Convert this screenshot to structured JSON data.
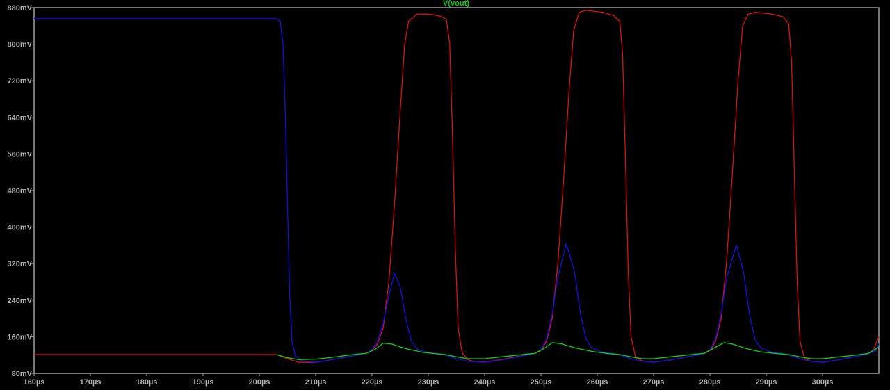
{
  "chart_data": {
    "type": "line",
    "title": "V(vout)",
    "title_color": "#00d000",
    "xlabel": "",
    "ylabel": "",
    "xlim": [
      160,
      310
    ],
    "ylim": [
      80,
      880
    ],
    "x_unit": "µs",
    "y_unit": "mV",
    "grid": false,
    "x_ticks": [
      "160µs",
      "170µs",
      "180µs",
      "190µs",
      "200µs",
      "210µs",
      "220µs",
      "230µs",
      "240µs",
      "250µs",
      "260µs",
      "270µs",
      "280µs",
      "290µs",
      "300µs"
    ],
    "x_tick_values": [
      160,
      170,
      180,
      190,
      200,
      210,
      220,
      230,
      240,
      250,
      260,
      270,
      280,
      290,
      300
    ],
    "y_ticks": [
      "80mV",
      "160mV",
      "240mV",
      "320mV",
      "400mV",
      "480mV",
      "560mV",
      "640mV",
      "720mV",
      "800mV",
      "880mV"
    ],
    "y_tick_values": [
      80,
      160,
      240,
      320,
      400,
      480,
      560,
      640,
      720,
      800,
      880
    ],
    "series": [
      {
        "name": "red-trace",
        "color": "#e01010",
        "points": [
          [
            160,
            121
          ],
          [
            203,
            121
          ],
          [
            205,
            112
          ],
          [
            207,
            104
          ],
          [
            210,
            104
          ],
          [
            213,
            110
          ],
          [
            216,
            117
          ],
          [
            219,
            124
          ],
          [
            220,
            130
          ],
          [
            221,
            145
          ],
          [
            222,
            180
          ],
          [
            223,
            280
          ],
          [
            224,
            450
          ],
          [
            225,
            650
          ],
          [
            225.8,
            800
          ],
          [
            226.5,
            850
          ],
          [
            228,
            866
          ],
          [
            230,
            866
          ],
          [
            232,
            862
          ],
          [
            233.2,
            855
          ],
          [
            233.8,
            800
          ],
          [
            234.3,
            600
          ],
          [
            234.8,
            350
          ],
          [
            235.3,
            180
          ],
          [
            236,
            125
          ],
          [
            237,
            110
          ],
          [
            238,
            106
          ],
          [
            240,
            105
          ],
          [
            243,
            110
          ],
          [
            246,
            117
          ],
          [
            249,
            124
          ],
          [
            250,
            130
          ],
          [
            251,
            150
          ],
          [
            252,
            200
          ],
          [
            253,
            320
          ],
          [
            254,
            500
          ],
          [
            255,
            700
          ],
          [
            255.8,
            830
          ],
          [
            256.8,
            870
          ],
          [
            258,
            874
          ],
          [
            261,
            870
          ],
          [
            263,
            862
          ],
          [
            264,
            850
          ],
          [
            264.5,
            780
          ],
          [
            265,
            550
          ],
          [
            265.5,
            300
          ],
          [
            266,
            160
          ],
          [
            266.8,
            115
          ],
          [
            268,
            107
          ],
          [
            270,
            104
          ],
          [
            273,
            109
          ],
          [
            276,
            116
          ],
          [
            279,
            123
          ],
          [
            280,
            130
          ],
          [
            281,
            150
          ],
          [
            282,
            200
          ],
          [
            283,
            330
          ],
          [
            284,
            520
          ],
          [
            285,
            720
          ],
          [
            285.8,
            840
          ],
          [
            286.8,
            866
          ],
          [
            288,
            870
          ],
          [
            291,
            866
          ],
          [
            293,
            860
          ],
          [
            294,
            845
          ],
          [
            294.5,
            760
          ],
          [
            295,
            520
          ],
          [
            295.5,
            280
          ],
          [
            296,
            150
          ],
          [
            296.8,
            112
          ],
          [
            298,
            106
          ],
          [
            300,
            104
          ],
          [
            303,
            110
          ],
          [
            306,
            117
          ],
          [
            308,
            122
          ],
          [
            309,
            130
          ],
          [
            310,
            160
          ]
        ]
      },
      {
        "name": "blue-trace",
        "color": "#1010e0",
        "points": [
          [
            160,
            856
          ],
          [
            203,
            856
          ],
          [
            203.7,
            850
          ],
          [
            204.2,
            800
          ],
          [
            204.6,
            650
          ],
          [
            205,
            450
          ],
          [
            205.4,
            250
          ],
          [
            205.8,
            150
          ],
          [
            206.4,
            118
          ],
          [
            207.5,
            108
          ],
          [
            210,
            104
          ],
          [
            213,
            110
          ],
          [
            216,
            117
          ],
          [
            219,
            124
          ],
          [
            220,
            132
          ],
          [
            221,
            150
          ],
          [
            222,
            190
          ],
          [
            223,
            250
          ],
          [
            224,
            299
          ],
          [
            225,
            270
          ],
          [
            226,
            200
          ],
          [
            227,
            150
          ],
          [
            228,
            133
          ],
          [
            230,
            125
          ],
          [
            232,
            123
          ],
          [
            233,
            120
          ],
          [
            235,
            112
          ],
          [
            237,
            106
          ],
          [
            240,
            104
          ],
          [
            243,
            109
          ],
          [
            246,
            116
          ],
          [
            249,
            124
          ],
          [
            250,
            132
          ],
          [
            251,
            155
          ],
          [
            252,
            210
          ],
          [
            253,
            290
          ],
          [
            254.5,
            364
          ],
          [
            256,
            300
          ],
          [
            257,
            210
          ],
          [
            258,
            155
          ],
          [
            259,
            135
          ],
          [
            261,
            126
          ],
          [
            263,
            123
          ],
          [
            264,
            120
          ],
          [
            266,
            112
          ],
          [
            268,
            106
          ],
          [
            270,
            104
          ],
          [
            273,
            109
          ],
          [
            276,
            116
          ],
          [
            279,
            123
          ],
          [
            280,
            132
          ],
          [
            281,
            155
          ],
          [
            282,
            210
          ],
          [
            283,
            290
          ],
          [
            284.7,
            361
          ],
          [
            286,
            300
          ],
          [
            287,
            210
          ],
          [
            288,
            155
          ],
          [
            289,
            135
          ],
          [
            291,
            126
          ],
          [
            293,
            123
          ],
          [
            294,
            120
          ],
          [
            296,
            112
          ],
          [
            298,
            106
          ],
          [
            300,
            104
          ],
          [
            303,
            110
          ],
          [
            306,
            117
          ],
          [
            308,
            122
          ],
          [
            309.5,
            130
          ],
          [
            310,
            145
          ]
        ]
      },
      {
        "name": "V(vout)",
        "color": "#10d010",
        "points": [
          [
            203,
            121
          ],
          [
            205,
            114
          ],
          [
            207,
            110
          ],
          [
            210,
            111
          ],
          [
            213,
            115
          ],
          [
            216,
            120
          ],
          [
            219,
            124
          ],
          [
            220.5,
            132
          ],
          [
            222,
            146
          ],
          [
            223.5,
            144
          ],
          [
            226,
            134
          ],
          [
            229,
            126
          ],
          [
            232,
            122
          ],
          [
            233,
            121
          ],
          [
            235,
            116
          ],
          [
            237,
            112
          ],
          [
            240,
            112
          ],
          [
            243,
            116
          ],
          [
            246,
            120
          ],
          [
            249,
            124
          ],
          [
            250.5,
            134
          ],
          [
            252,
            147
          ],
          [
            253.5,
            145
          ],
          [
            256,
            136
          ],
          [
            259,
            128
          ],
          [
            262,
            123
          ],
          [
            264,
            121
          ],
          [
            266,
            116
          ],
          [
            268,
            112
          ],
          [
            270,
            112
          ],
          [
            273,
            116
          ],
          [
            276,
            120
          ],
          [
            279,
            124
          ],
          [
            280.5,
            134
          ],
          [
            282.5,
            147
          ],
          [
            284,
            144
          ],
          [
            286.5,
            134
          ],
          [
            289,
            127
          ],
          [
            292,
            123
          ],
          [
            294,
            121
          ],
          [
            296,
            116
          ],
          [
            298,
            112
          ],
          [
            300,
            112
          ],
          [
            303,
            116
          ],
          [
            306,
            120
          ],
          [
            308,
            123
          ],
          [
            310,
            137
          ]
        ]
      }
    ]
  }
}
